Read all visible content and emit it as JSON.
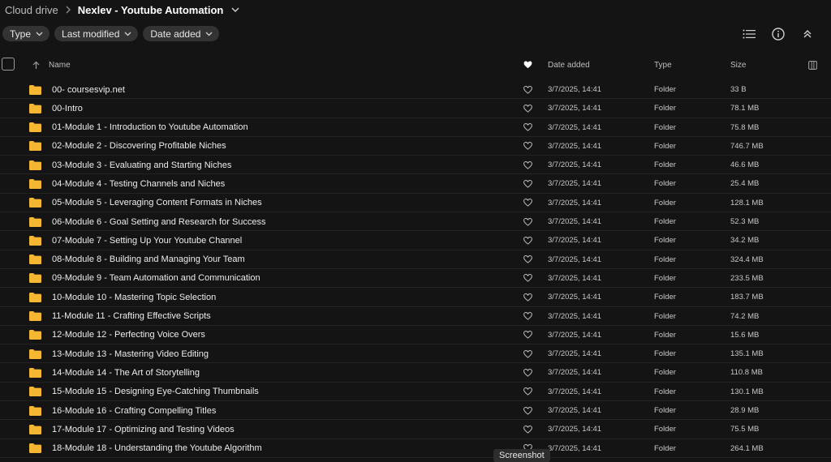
{
  "breadcrumb": {
    "root": "Cloud drive",
    "current": "Nexlev - Youtube Automation"
  },
  "filters": [
    {
      "label": "Type"
    },
    {
      "label": "Last modified"
    },
    {
      "label": "Date added"
    }
  ],
  "columns": {
    "name": "Name",
    "date_added": "Date added",
    "type": "Type",
    "size": "Size"
  },
  "icons": {
    "folder_color": "#f5b731"
  },
  "rows": [
    {
      "name": "00- coursesvip.net",
      "date": "3/7/2025, 14:41",
      "type": "Folder",
      "size": "33 B"
    },
    {
      "name": "00-Intro",
      "date": "3/7/2025, 14:41",
      "type": "Folder",
      "size": "78.1 MB"
    },
    {
      "name": "01-Module 1 - Introduction to Youtube Automation",
      "date": "3/7/2025, 14:41",
      "type": "Folder",
      "size": "75.8 MB"
    },
    {
      "name": "02-Module 2 - Discovering Profitable Niches",
      "date": "3/7/2025, 14:41",
      "type": "Folder",
      "size": "746.7 MB"
    },
    {
      "name": "03-Module 3 - Evaluating and Starting Niches",
      "date": "3/7/2025, 14:41",
      "type": "Folder",
      "size": "46.6 MB"
    },
    {
      "name": "04-Module 4 - Testing Channels and Niches",
      "date": "3/7/2025, 14:41",
      "type": "Folder",
      "size": "25.4 MB"
    },
    {
      "name": "05-Module 5 - Leveraging Content Formats in Niches",
      "date": "3/7/2025, 14:41",
      "type": "Folder",
      "size": "128.1 MB"
    },
    {
      "name": "06-Module 6 - Goal Setting and Research for Success",
      "date": "3/7/2025, 14:41",
      "type": "Folder",
      "size": "52.3 MB"
    },
    {
      "name": "07-Module 7 - Setting Up Your Youtube Channel",
      "date": "3/7/2025, 14:41",
      "type": "Folder",
      "size": "34.2 MB"
    },
    {
      "name": "08-Module 8 - Building and Managing Your Team",
      "date": "3/7/2025, 14:41",
      "type": "Folder",
      "size": "324.4 MB"
    },
    {
      "name": "09-Module 9 - Team Automation and Communication",
      "date": "3/7/2025, 14:41",
      "type": "Folder",
      "size": "233.5 MB"
    },
    {
      "name": "10-Module 10 - Mastering Topic Selection",
      "date": "3/7/2025, 14:41",
      "type": "Folder",
      "size": "183.7 MB"
    },
    {
      "name": "11-Module 11 - Crafting Effective Scripts",
      "date": "3/7/2025, 14:41",
      "type": "Folder",
      "size": "74.2 MB"
    },
    {
      "name": "12-Module 12 - Perfecting Voice Overs",
      "date": "3/7/2025, 14:41",
      "type": "Folder",
      "size": "15.6 MB"
    },
    {
      "name": "13-Module 13 - Mastering Video Editing",
      "date": "3/7/2025, 14:41",
      "type": "Folder",
      "size": "135.1 MB"
    },
    {
      "name": "14-Module 14 - The Art of Storytelling",
      "date": "3/7/2025, 14:41",
      "type": "Folder",
      "size": "110.8 MB"
    },
    {
      "name": "15-Module 15 - Designing Eye-Catching Thumbnails",
      "date": "3/7/2025, 14:41",
      "type": "Folder",
      "size": "130.1 MB"
    },
    {
      "name": "16-Module 16 - Crafting Compelling Titles",
      "date": "3/7/2025, 14:41",
      "type": "Folder",
      "size": "28.9 MB"
    },
    {
      "name": "17-Module 17 - Optimizing and Testing Videos",
      "date": "3/7/2025, 14:41",
      "type": "Folder",
      "size": "75.5 MB"
    },
    {
      "name": "18-Module 18 - Understanding the Youtube Algorithm",
      "date": "3/7/2025, 14:41",
      "type": "Folder",
      "size": "264.1 MB"
    }
  ],
  "tooltip": "Screenshot"
}
